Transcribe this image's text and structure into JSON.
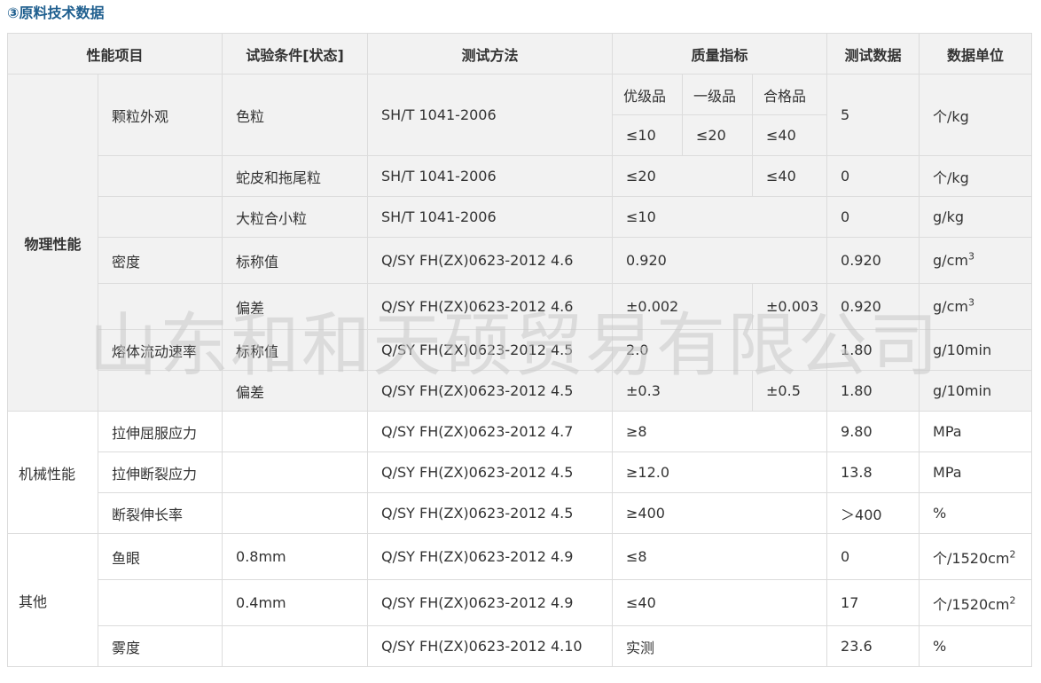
{
  "section_title": "③原料技术数据",
  "headers": {
    "item": "性能项目",
    "condition": "试验条件[状态]",
    "method": "测试方法",
    "quality": "质量指标",
    "test_data": "测试数据",
    "unit": "数据单位"
  },
  "grades": {
    "superior": "优级品",
    "first": "一级品",
    "qualified": "合格品"
  },
  "categories": {
    "physical": "物理性能",
    "mechanical": "机械性能",
    "other": "其他"
  },
  "rows": [
    {
      "item": "颗粒外观",
      "condition": "色粒",
      "method": "SH/T 1041-2006",
      "q1": "≤10",
      "q2": "≤20",
      "q3": "≤40",
      "data": "5",
      "unit": "个/kg"
    },
    {
      "item": "",
      "condition": "蛇皮和拖尾粒",
      "method": "SH/T 1041-2006",
      "q12": "≤20",
      "q3": "≤40",
      "data": "0",
      "unit": "个/kg"
    },
    {
      "item": "",
      "condition": "大粒合小粒",
      "method": "SH/T 1041-2006",
      "q": "≤10",
      "data": "0",
      "unit": "g/kg"
    },
    {
      "item": "密度",
      "condition": "标称值",
      "method": "Q/SY FH(ZX)0623-2012 4.6",
      "q": "0.920",
      "data": "0.920",
      "unit_base": "g/cm",
      "unit_sup": "3"
    },
    {
      "item": "",
      "condition": "偏差",
      "method": "Q/SY FH(ZX)0623-2012 4.6",
      "q12": "±0.002",
      "q3": "±0.003",
      "data": "0.920",
      "unit_base": "g/cm",
      "unit_sup": "3"
    },
    {
      "item": "熔体流动速率",
      "condition": "标称值",
      "method": "Q/SY FH(ZX)0623-2012 4.5",
      "q": "2.0",
      "data": "1.80",
      "unit": "g/10min"
    },
    {
      "item": "",
      "condition": "偏差",
      "method": "Q/SY FH(ZX)0623-2012 4.5",
      "q12": "±0.3",
      "q3": "±0.5",
      "data": "1.80",
      "unit": "g/10min"
    },
    {
      "item": "拉伸屈服应力",
      "condition": "",
      "method": "Q/SY FH(ZX)0623-2012 4.7",
      "q": "≥8",
      "data": "9.80",
      "unit": "MPa"
    },
    {
      "item": "拉伸断裂应力",
      "condition": "",
      "method": "Q/SY FH(ZX)0623-2012 4.5",
      "q": "≥12.0",
      "data": "13.8",
      "unit": "MPa"
    },
    {
      "item": "断裂伸长率",
      "condition": "",
      "method": "Q/SY FH(ZX)0623-2012 4.5",
      "q": "≥400",
      "data": "＞400",
      "unit": "%"
    },
    {
      "item": "鱼眼",
      "condition": "0.8mm",
      "method": "Q/SY FH(ZX)0623-2012 4.9",
      "q": "≤8",
      "data": "0",
      "unit_base": "个/1520cm",
      "unit_sup": "2"
    },
    {
      "item": "",
      "condition": "0.4mm",
      "method": "Q/SY FH(ZX)0623-2012 4.9",
      "q": "≤40",
      "data": "17",
      "unit_base": "个/1520cm",
      "unit_sup": "2"
    },
    {
      "item": "雾度",
      "condition": "",
      "method": "Q/SY FH(ZX)0623-2012 4.10",
      "q": "实测",
      "data": "23.6",
      "unit": "%"
    }
  ],
  "watermark": "山东和和天硕贸易有限公司"
}
